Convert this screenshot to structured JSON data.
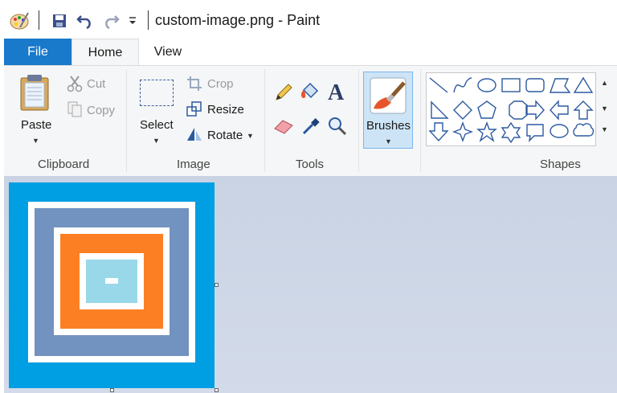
{
  "window": {
    "title": "custom-image.png - Paint"
  },
  "quick_access": {
    "icons": [
      "paint-app-icon",
      "save-icon",
      "undo-icon",
      "redo-icon",
      "customize-dropdown-icon"
    ]
  },
  "tabs": [
    {
      "label": "File"
    },
    {
      "label": "Home"
    },
    {
      "label": "View"
    }
  ],
  "ribbon": {
    "clipboard": {
      "paste": "Paste",
      "cut": "Cut",
      "copy": "Copy",
      "group_label": "Clipboard"
    },
    "image": {
      "select": "Select",
      "crop": "Crop",
      "resize": "Resize",
      "rotate": "Rotate",
      "group_label": "Image"
    },
    "tools": {
      "group_label": "Tools",
      "icons": [
        "pencil-icon",
        "fill-bucket-icon",
        "text-icon",
        "eraser-icon",
        "color-picker-icon",
        "magnifier-icon"
      ]
    },
    "brushes": {
      "label": "Brushes"
    },
    "shapes": {
      "group_label": "Shapes"
    }
  },
  "colors": {
    "accent": "#1979ca",
    "canvas_bg": "#009fe3",
    "ring_slate": "#7292bf",
    "ring_orange": "#fd7f23",
    "inner_lightblue": "#99d8e9",
    "white": "#ffffff"
  }
}
